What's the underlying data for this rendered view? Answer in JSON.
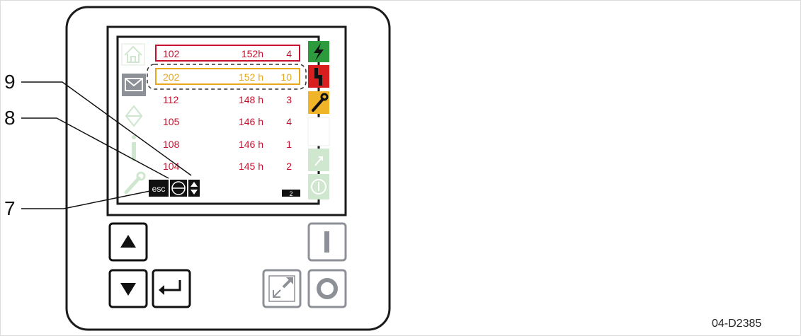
{
  "callouts": [
    {
      "number": "9",
      "target": "up-down-arrow-icon"
    },
    {
      "number": "8",
      "target": "dash-circle-icon"
    },
    {
      "number": "7",
      "target": "esc-button"
    }
  ],
  "display": {
    "rows": [
      {
        "code": "102",
        "hours": "152h",
        "count": "4",
        "state": "selected-red"
      },
      {
        "code": "202",
        "hours": "152 h",
        "count": "10",
        "state": "selected-orange"
      },
      {
        "code": "112",
        "hours": "148 h",
        "count": "3",
        "state": "normal"
      },
      {
        "code": "105",
        "hours": "146 h",
        "count": "4",
        "state": "normal"
      },
      {
        "code": "108",
        "hours": "146 h",
        "count": "1",
        "state": "normal"
      },
      {
        "code": "104",
        "hours": "145 h",
        "count": "2",
        "state": "normal"
      }
    ],
    "esc_label": "esc",
    "page_indicator": "2"
  },
  "drawing_code": "04-D2385",
  "colors": {
    "red_text": "#c8102e",
    "orange_text": "#e8a71d",
    "green": "#2e9a3e",
    "red_icon": "#d81e1e",
    "yellow_icon": "#f0b429",
    "faded_green": "#cfe6cf",
    "grey_icon": "#8d9097"
  }
}
